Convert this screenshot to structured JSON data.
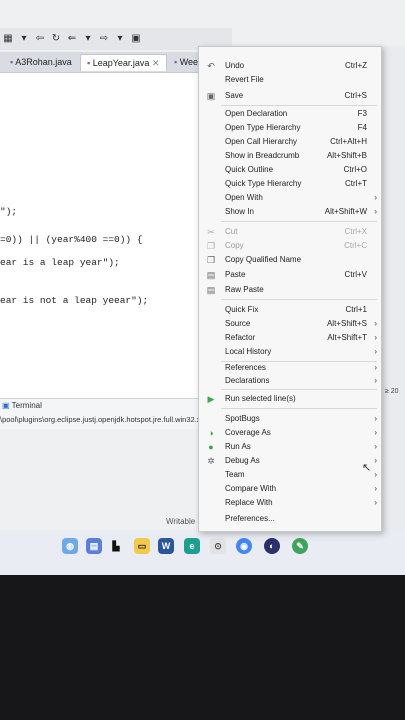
{
  "editor_tabs": [
    "A3Rohan.java",
    "LeapYear.java",
    "Weekday.java"
  ],
  "code_lines": [
    "\");",
    "=0)) || (year%400 ==0)) {",
    "ear is a leap year\");",
    "ear is not a leap yeear\");"
  ],
  "console": {
    "title": "Terminal",
    "path": "\\pool\\plugins\\org.eclipse.justj.openjdk.hotspot.jre.full.win32.x86_"
  },
  "status": {
    "writable": "Writable"
  },
  "right_edge_text": "≥ 20",
  "menu": {
    "items": [
      {
        "label": "Undo",
        "shortcut": "Ctrl+Z",
        "icon": "undo-icon"
      },
      {
        "label": "Revert File",
        "shortcut": "",
        "icon": ""
      },
      {
        "label": "Save",
        "shortcut": "Ctrl+S",
        "icon": "save-icon"
      },
      {
        "label": "Open Declaration",
        "shortcut": "F3"
      },
      {
        "label": "Open Type Hierarchy",
        "shortcut": "F4"
      },
      {
        "label": "Open Call Hierarchy",
        "shortcut": "Ctrl+Alt+H"
      },
      {
        "label": "Show in Breadcrumb",
        "shortcut": "Alt+Shift+B"
      },
      {
        "label": "Quick Outline",
        "shortcut": "Ctrl+O"
      },
      {
        "label": "Quick Type Hierarchy",
        "shortcut": "Ctrl+T"
      },
      {
        "label": "Open With",
        "shortcut": ""
      },
      {
        "label": "Show In",
        "shortcut": "Alt+Shift+W"
      },
      {
        "label": "Cut",
        "shortcut": "Ctrl+X"
      },
      {
        "label": "Copy",
        "shortcut": "Ctrl+C"
      },
      {
        "label": "Copy Qualified Name",
        "shortcut": ""
      },
      {
        "label": "Paste",
        "shortcut": "Ctrl+V"
      },
      {
        "label": "Raw Paste",
        "shortcut": ""
      },
      {
        "label": "Quick Fix",
        "shortcut": "Ctrl+1"
      },
      {
        "label": "Source",
        "shortcut": "Alt+Shift+S"
      },
      {
        "label": "Refactor",
        "shortcut": "Alt+Shift+T"
      },
      {
        "label": "Local History",
        "shortcut": ""
      },
      {
        "label": "References",
        "shortcut": ""
      },
      {
        "label": "Declarations",
        "shortcut": ""
      },
      {
        "label": "Run selected line(s)",
        "shortcut": ""
      },
      {
        "label": "SpotBugs",
        "shortcut": ""
      },
      {
        "label": "Coverage As",
        "shortcut": ""
      },
      {
        "label": "Run As",
        "shortcut": ""
      },
      {
        "label": "Debug As",
        "shortcut": ""
      },
      {
        "label": "Team",
        "shortcut": ""
      },
      {
        "label": "Compare With",
        "shortcut": ""
      },
      {
        "label": "Replace With",
        "shortcut": ""
      },
      {
        "label": "Preferences...",
        "shortcut": ""
      }
    ]
  },
  "colors": {
    "menu_bg": "#f7f7f8",
    "run_green": "#3ca84a",
    "accent_blue": "#2f6fc4"
  }
}
